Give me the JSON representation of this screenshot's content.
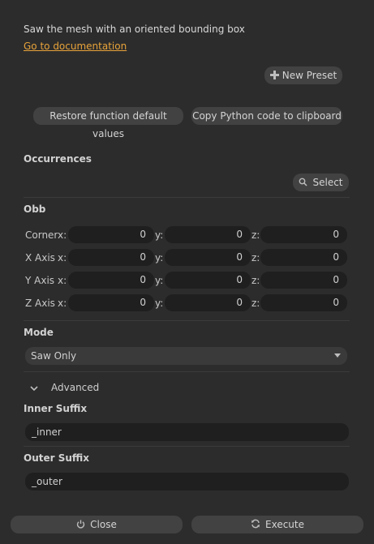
{
  "description": "Saw the mesh with an oriented bounding box",
  "doc_link": "Go to documentation",
  "preset_button": "New Preset",
  "restore_button": "Restore function default values",
  "copy_button": "Copy Python code to clipboard",
  "occurrences": {
    "title": "Occurrences",
    "select_button": "Select"
  },
  "obb": {
    "title": "Obb",
    "axis_labels": {
      "x": "x:",
      "y": "y:",
      "z": "z:"
    },
    "rows": [
      {
        "label": "Corner",
        "x": "0",
        "y": "0",
        "z": "0"
      },
      {
        "label": "X Axis",
        "x": "0",
        "y": "0",
        "z": "0"
      },
      {
        "label": "Y Axis",
        "x": "0",
        "y": "0",
        "z": "0"
      },
      {
        "label": "Z Axis",
        "x": "0",
        "y": "0",
        "z": "0"
      }
    ]
  },
  "mode": {
    "title": "Mode",
    "value": "Saw Only"
  },
  "advanced": {
    "label": "Advanced"
  },
  "inner_suffix": {
    "title": "Inner Suffix",
    "value": "_inner"
  },
  "outer_suffix": {
    "title": "Outer Suffix",
    "value": "_outer"
  },
  "footer": {
    "close": "Close",
    "execute": "Execute"
  },
  "colors": {
    "background": "#2c2c2c",
    "link": "#e8a33a",
    "field": "#1f1f1f",
    "button": "#424242"
  }
}
